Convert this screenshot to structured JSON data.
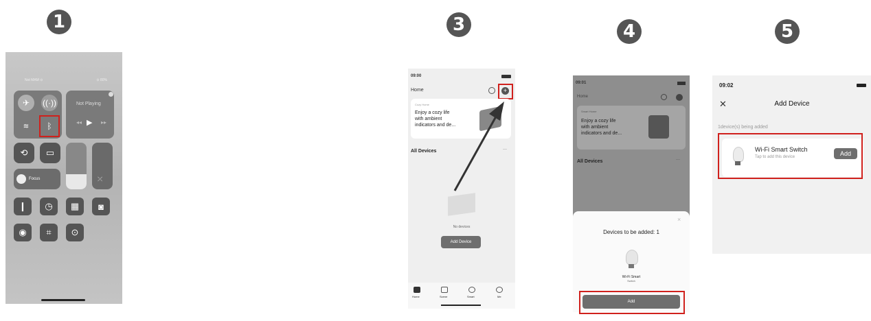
{
  "steps": {
    "s1": "1",
    "s3": "3",
    "s4": "4",
    "s5": "5"
  },
  "panel1": {
    "status_left": "Not MAM ⊙",
    "status_right": "⊙ 80%",
    "media_label": "Not Playing",
    "focus_label": "Focus"
  },
  "panel3": {
    "time": "09:00",
    "home_label": "Home",
    "card_small": "Cozy Home",
    "card_title_l1": "Enjoy a cozy life",
    "card_title_l2": "with ambient",
    "card_title_l3": "indicators and de...",
    "all_devices": "All Devices",
    "more": "···",
    "no_devices": "No devices",
    "add_device_btn": "Add Device",
    "nav": [
      "Home",
      "Scene",
      "Smart",
      "Me"
    ]
  },
  "panel4": {
    "time": "09:01",
    "home_label": "Home",
    "card_small": "Smart Home",
    "card_title_l1": "Enjoy a cozy life",
    "card_title_l2": "with ambient",
    "card_title_l3": "indicators and de...",
    "all_devices": "All Devices",
    "more": "···",
    "sheet_title": "Devices to be added: 1",
    "device_name_l1": "Wi-Fi Smart",
    "device_name_l2": "Switch",
    "add_btn": "Add",
    "close": "×"
  },
  "panel5": {
    "time": "09:02",
    "title": "Add Device",
    "close": "✕",
    "being_added": "1device(s) being added",
    "device_name": "Wi-Fi Smart Switch",
    "device_sub": "Tap to add this device",
    "add_btn": "Add"
  },
  "colors": {
    "highlight": "#d0201c",
    "badge": "#555555"
  }
}
